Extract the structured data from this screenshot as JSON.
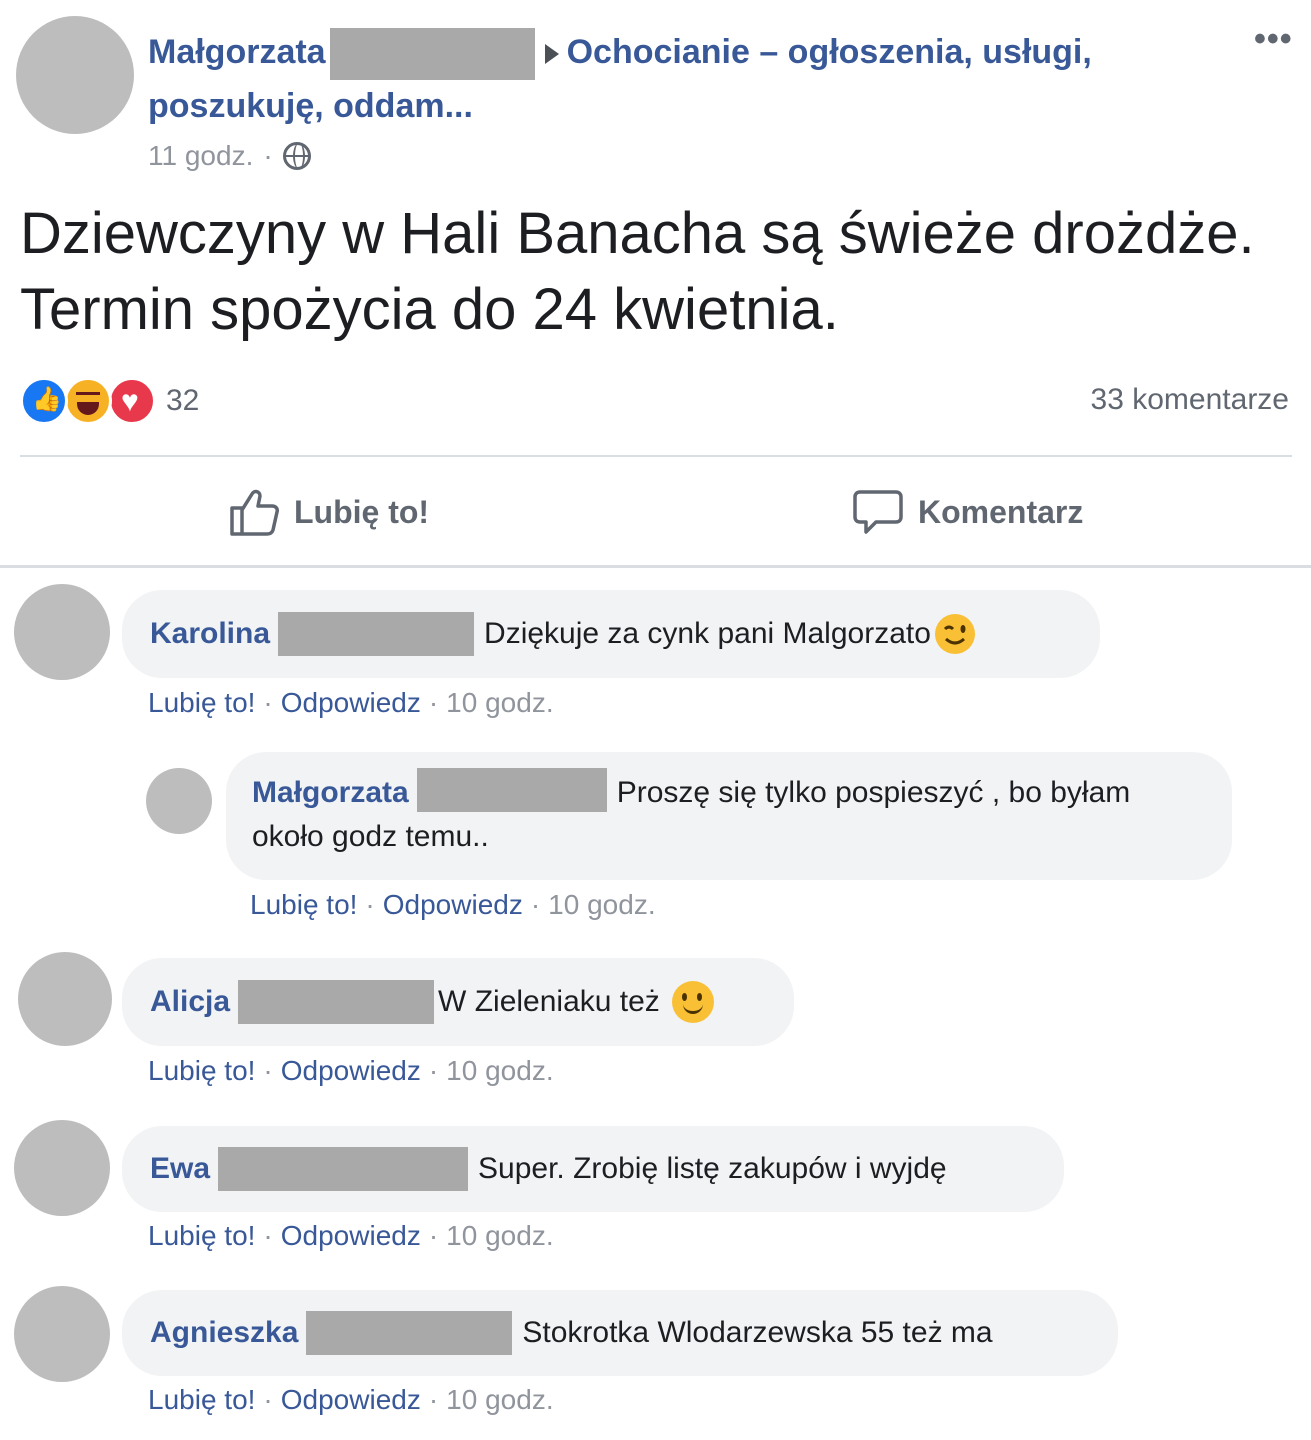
{
  "post": {
    "author": "Małgorzata",
    "group": "Ochocianie – ogłoszenia, usługi, poszukuję, oddam...",
    "time": "11 godz.",
    "separator": "·",
    "text": "Dziewczyny w Hali Banacha są świeże drożdże. Termin spożycia do 24 kwietnia.",
    "reaction_count": "32",
    "comments_count": "33 komentarze",
    "more": "•••",
    "reactions": [
      "like",
      "haha",
      "love"
    ],
    "icons": {
      "visibility": "globe-icon"
    }
  },
  "actions": {
    "like": "Lubię to!",
    "comment": "Komentarz"
  },
  "comment_actions": {
    "like": "Lubię to!",
    "reply": "Odpowiedz",
    "separator": "·"
  },
  "comments": [
    {
      "author": "Karolina",
      "text": "Dziękuje za cynk pani Malgorzato",
      "time": "10 godz.",
      "emoji": "wink"
    },
    {
      "author": "Małgorzata",
      "text": "Proszę się tylko pospieszyć , bo byłam około godz temu..",
      "time": "10 godz.",
      "reply": true
    },
    {
      "author": "Alicja",
      "text": "W Zieleniaku też",
      "time": "10 godz.",
      "emoji": "smile"
    },
    {
      "author": "Ewa",
      "text": "Super. Zrobię listę zakupów i wyjdę",
      "time": "10 godz."
    },
    {
      "author": "Agnieszka",
      "text": "Stokrotka Wlodarzewska 55 też ma",
      "time": "10 godz."
    }
  ],
  "colors": {
    "link": "#385898",
    "meta": "#90949c",
    "bubble": "#f2f3f5",
    "like_blue": "#1877f2",
    "love_red": "#e8384b",
    "haha_yellow": "#f7b125",
    "redaction": "#a9a9a9"
  }
}
